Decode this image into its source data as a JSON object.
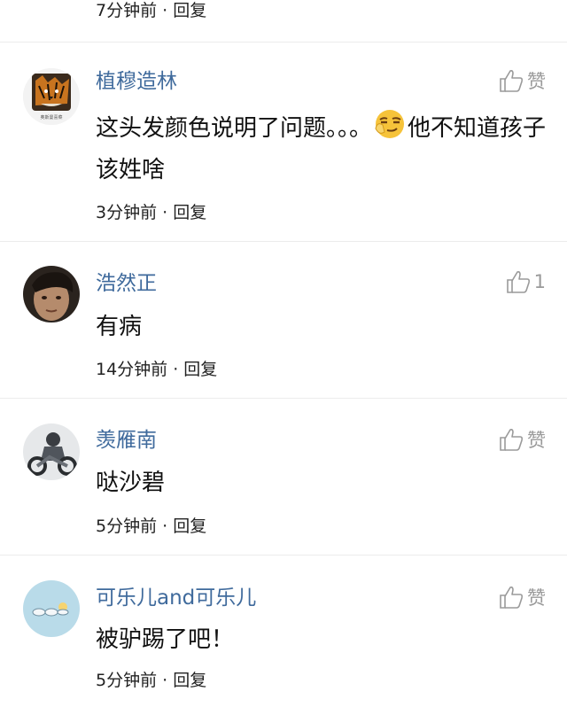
{
  "top_meta": "7分钟前 · 回复",
  "comments": [
    {
      "username": "植穆造林",
      "text_before_emoji": "这头发颜色说明了问题。。。",
      "emoji": "smirk-emoji-icon",
      "text_after_emoji": "他不知道孩子该姓啥",
      "meta": "3分钟前 · 回复",
      "like_label": "赞",
      "avatar": "tiger-avatar",
      "avatar_caption": "奥斯曼喜菜"
    },
    {
      "username": "浩然正",
      "text": "有病",
      "meta": "14分钟前 · 回复",
      "like_count": "1",
      "avatar": "boy-face-avatar"
    },
    {
      "username": "羡雁南",
      "text": "哒沙碧",
      "meta": "5分钟前 · 回复",
      "like_label": "赞",
      "avatar": "motorcyclist-avatar"
    },
    {
      "username": "可乐儿and可乐儿",
      "text": "被驴踢了吧！",
      "meta": "5分钟前 · 回复",
      "like_label": "赞",
      "avatar": "cartoon-sky-avatar"
    }
  ],
  "colors": {
    "username": "#3f6a9c",
    "text": "#111111",
    "meta": "#222222",
    "like": "#9a9a9a"
  }
}
